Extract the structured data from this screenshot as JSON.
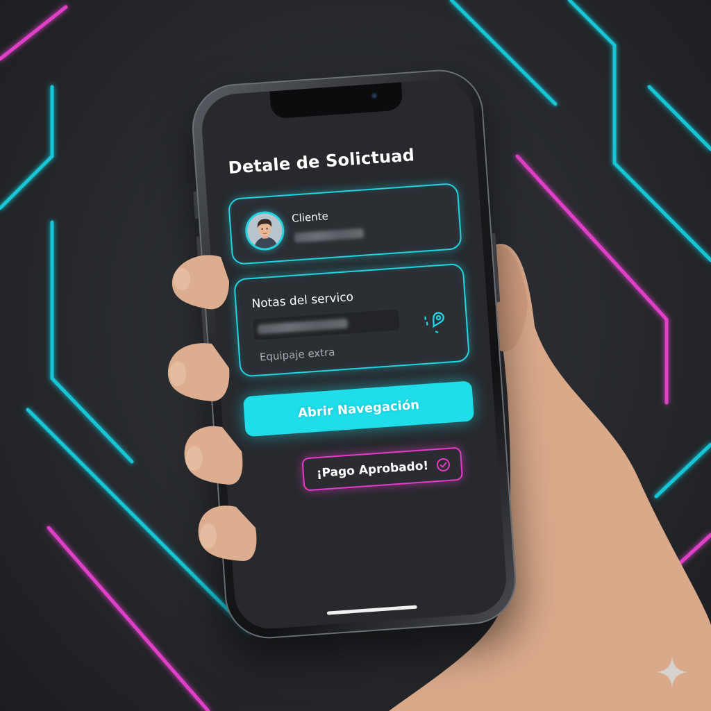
{
  "screen": {
    "title": "Detale de Solictuad",
    "client_card": {
      "label": "Cliente",
      "avatar_icon": "user-avatar-icon"
    },
    "notes_card": {
      "label": "Notas del servico",
      "extra_note": "Equipaje extra",
      "nav_icon": "location-pin-icon"
    },
    "primary_action": {
      "label": "Abrir Navegación"
    },
    "status": {
      "text": "¡Pago Aprobado!",
      "icon": "check-circle-icon"
    }
  },
  "colors": {
    "accent_cyan": "#1fdde9",
    "accent_magenta": "#e23cc9",
    "screen_bg": "#27292d",
    "card_bg": "#2b2e33"
  }
}
